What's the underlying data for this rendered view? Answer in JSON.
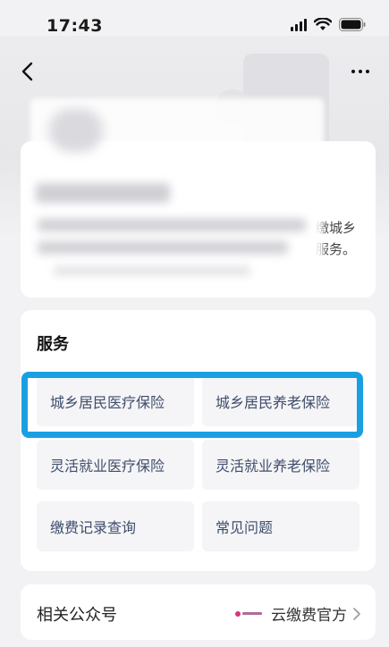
{
  "status_bar": {
    "time": "17:43"
  },
  "intro": {
    "visible_text_line1": "缴城乡",
    "visible_text_line2": "服务。"
  },
  "service": {
    "title": "服务",
    "items": [
      {
        "label": "城乡居民医疗保险"
      },
      {
        "label": "城乡居民养老保险"
      },
      {
        "label": "灵活就业医疗保险"
      },
      {
        "label": "灵活就业养老保险"
      },
      {
        "label": "缴费记录查询"
      },
      {
        "label": "常见问题"
      }
    ]
  },
  "official": {
    "label": "相关公众号",
    "account_name": "云缴费官方"
  },
  "colors": {
    "highlight": "#1aa0e2",
    "service_text": "#3f4d6b",
    "page_bg": "#f2f2f4"
  }
}
